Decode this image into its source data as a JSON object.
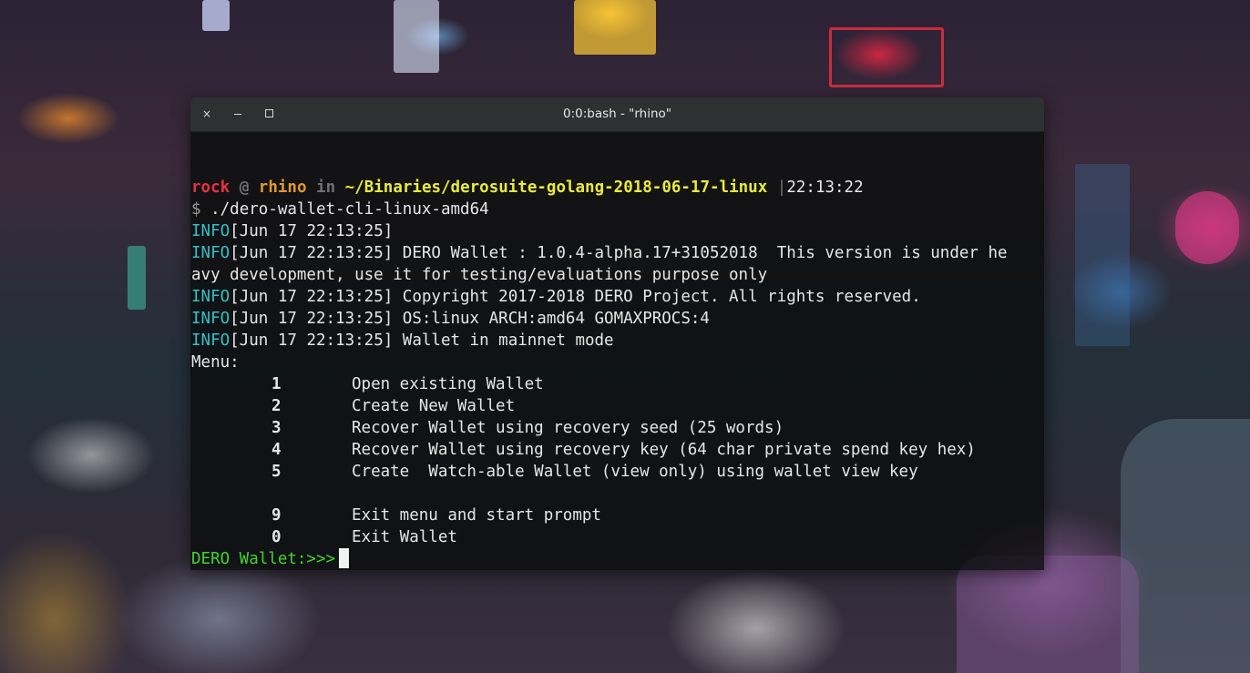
{
  "window": {
    "title": "0:0:bash - \"rhino\"",
    "close_label": "×"
  },
  "prompt": {
    "user": "rock",
    "at": "@",
    "host": "rhino",
    "in": "in",
    "path": "~/Binaries/derosuite-golang-2018-06-17-linux",
    "separator": "|",
    "time": "22:13:22",
    "dollar": "$",
    "command": "./dero-wallet-cli-linux-amd64"
  },
  "log": [
    {
      "level": "INFO",
      "text": "[Jun 17 22:13:25]"
    },
    {
      "level": "INFO",
      "text": "[Jun 17 22:13:25] DERO Wallet : 1.0.4-alpha.17+31052018  This version is under he"
    },
    {
      "level": "",
      "text": "avy development, use it for testing/evaluations purpose only"
    },
    {
      "level": "INFO",
      "text": "[Jun 17 22:13:25] Copyright 2017-2018 DERO Project. All rights reserved."
    },
    {
      "level": "INFO",
      "text": "[Jun 17 22:13:25] OS:linux ARCH:amd64 GOMAXPROCS:4"
    },
    {
      "level": "INFO",
      "text": "[Jun 17 22:13:25] Wallet in mainnet mode"
    }
  ],
  "menu": {
    "heading": "Menu:",
    "items": [
      {
        "num": "1",
        "label": "Open existing Wallet"
      },
      {
        "num": "2",
        "label": "Create New Wallet"
      },
      {
        "num": "3",
        "label": "Recover Wallet using recovery seed (25 words)"
      },
      {
        "num": "4",
        "label": "Recover Wallet using recovery key (64 char private spend key hex)"
      },
      {
        "num": "5",
        "label": "Create  Watch-able Wallet (view only) using wallet view key"
      },
      {
        "num": "9",
        "label": "Exit menu and start prompt"
      },
      {
        "num": "0",
        "label": "Exit Wallet"
      }
    ]
  },
  "wallet_prompt": "DERO Wallet:>>>",
  "colors": {
    "user": "#e8323c",
    "host": "#e39a2a",
    "path": "#e8ec39",
    "info": "#33c1c8",
    "wallet_prompt": "#3fd62a"
  }
}
